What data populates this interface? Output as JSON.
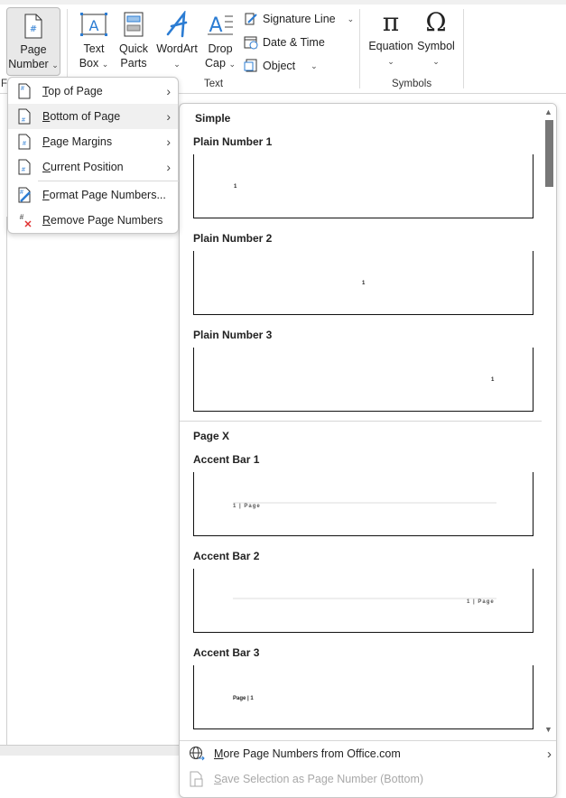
{
  "ribbon": {
    "page_number": {
      "line1": "Page",
      "line2": "Number"
    },
    "text_box": {
      "line1": "Text",
      "line2": "Box"
    },
    "quick_parts": {
      "line1": "Quick",
      "line2": "Parts"
    },
    "wordart": {
      "line1": "WordArt"
    },
    "drop_cap": {
      "line1": "Drop",
      "line2": "Cap"
    },
    "signature_line": "Signature Line",
    "date_time": "Date & Time",
    "object": "Object",
    "equation": "Equation",
    "symbol": "Symbol",
    "groups": {
      "header_footer_partial": "F",
      "text": "Text",
      "symbols": "Symbols"
    }
  },
  "menu": {
    "items": [
      {
        "label": "Top of Page",
        "key": "T",
        "rest": "op of Page",
        "submenu": true
      },
      {
        "label": "Bottom of Page",
        "key": "B",
        "rest": "ottom of Page",
        "submenu": true,
        "highlighted": true
      },
      {
        "label": "Page Margins",
        "key": "P",
        "rest": "age Margins",
        "submenu": true
      },
      {
        "label": "Current Position",
        "key": "C",
        "rest": "urrent Position",
        "submenu": true
      },
      {
        "label": "Format Page Numbers...",
        "key": "F",
        "rest": "ormat Page Numbers..."
      },
      {
        "label": "Remove Page Numbers",
        "key": "R",
        "rest": "emove Page Numbers"
      }
    ]
  },
  "gallery": {
    "sections": [
      {
        "title": "Simple"
      },
      {
        "title": "Page X"
      }
    ],
    "items": [
      {
        "name": "Plain Number 1",
        "preview": "1"
      },
      {
        "name": "Plain Number 2",
        "preview": "1"
      },
      {
        "name": "Plain Number 3",
        "preview": "1"
      },
      {
        "name": "Accent Bar 1",
        "preview": "1 | Page"
      },
      {
        "name": "Accent Bar 2",
        "preview": "1 | Page"
      },
      {
        "name": "Accent Bar 3",
        "preview": "Page | 1"
      }
    ],
    "more": {
      "key": "M",
      "rest": "ore Page Numbers from Office.com"
    },
    "save": {
      "key": "S",
      "rest": "ave Selection as Page Number (Bottom)",
      "disabled": true
    }
  },
  "colors": {
    "accent": "#2b7cd3",
    "disabled": "#a8a8a8",
    "remove_x": "#e03030"
  }
}
